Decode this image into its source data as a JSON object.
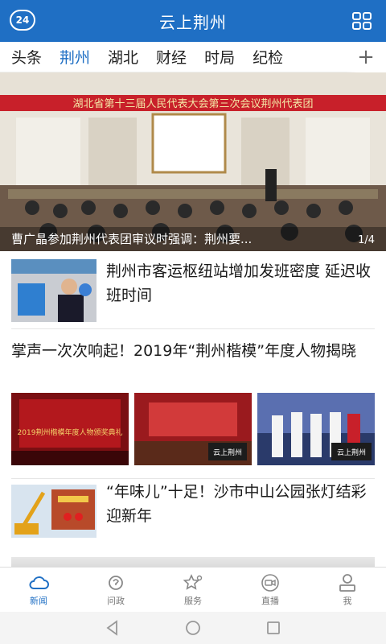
{
  "header": {
    "logo_text": "24",
    "title": "云上荆州",
    "icons": {
      "logo": "channel-24-icon",
      "menu": "grid-menu-icon"
    }
  },
  "tabs": [
    "头条",
    "荆州",
    "湖北",
    "财经",
    "时局",
    "纪检"
  ],
  "active_tab": "荆州",
  "add_tab_symbol": "+",
  "banner": {
    "headline": "曹广晶参加荆州代表团审议时强调：荆州要...",
    "page": "1/4",
    "image_banner_text": "湖北省第十三届人民代表大会第三次会议荆州代表团"
  },
  "news": [
    {
      "title": "荆州市客运枢纽站增加发班密度 延迟收班时间",
      "layout": "thumb-left"
    },
    {
      "title": "掌声一次次响起！2019年“荆州楷模”年度人物揭晓",
      "layout": "three-images",
      "image_texts": [
        "2019荆州楷模年度人物颁奖典礼",
        "云上荆州",
        "云上荆州"
      ]
    },
    {
      "title": "“年味儿”十足！沙市中山公园张灯结彩迎新年",
      "layout": "thumb-left"
    }
  ],
  "bottom_nav": [
    {
      "label": "新闻",
      "icon": "cloud-icon",
      "active": true
    },
    {
      "label": "问政",
      "icon": "question-hand-icon",
      "active": false
    },
    {
      "label": "服务",
      "icon": "star-service-icon",
      "active": false
    },
    {
      "label": "直播",
      "icon": "video-camera-icon",
      "active": false
    },
    {
      "label": "我",
      "icon": "person-icon",
      "active": false
    }
  ],
  "colors": {
    "brand": "#1f6fc4",
    "banner_red": "#c8202a"
  },
  "system_nav": [
    "back-icon",
    "home-icon",
    "recents-icon"
  ]
}
